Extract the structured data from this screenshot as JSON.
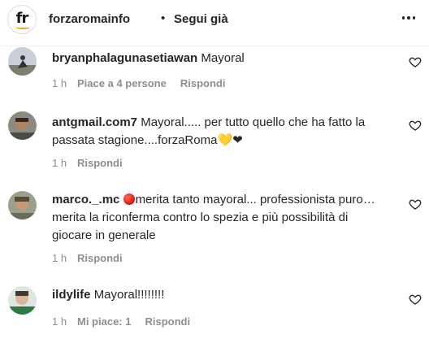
{
  "header": {
    "avatar_text": "fr",
    "username": "forzaromainfo",
    "separator": "•",
    "follow_label": "Segui già"
  },
  "comments": [
    {
      "username": "bryanphalagunasetiawan",
      "text": "Mayoral",
      "time": "1 h",
      "likes": "Piace a 4 persone",
      "reply": "Rispondi"
    },
    {
      "username": "antgmail.com7",
      "text": "Mayoral..... per tutto quello che ha fatto la",
      "text2": "passata stagione....forzaRoma",
      "emoji_yellow_heart": "💛",
      "emoji_black_heart": "❤",
      "time": "1 h",
      "reply": "Rispondi"
    },
    {
      "username": "marco._.mc",
      "text": "merita tanto mayoral... professionista puro…",
      "text2": "merita la riconferma contro lo spezia e più possibilità di",
      "text3": "giocare in generale",
      "time": "1 h",
      "reply": "Rispondi"
    },
    {
      "username": "ildylife",
      "text": "Mayoral!!!!!!!!",
      "time": "1 h",
      "likes": "Mi piace: 1",
      "reply": "Rispondi"
    }
  ],
  "icons": {
    "more": "more-options-icon",
    "like": "heart-outline-icon"
  },
  "colors": {
    "text": "#262626",
    "muted": "#8e8e8e",
    "brand_orange": "#f0a021"
  }
}
